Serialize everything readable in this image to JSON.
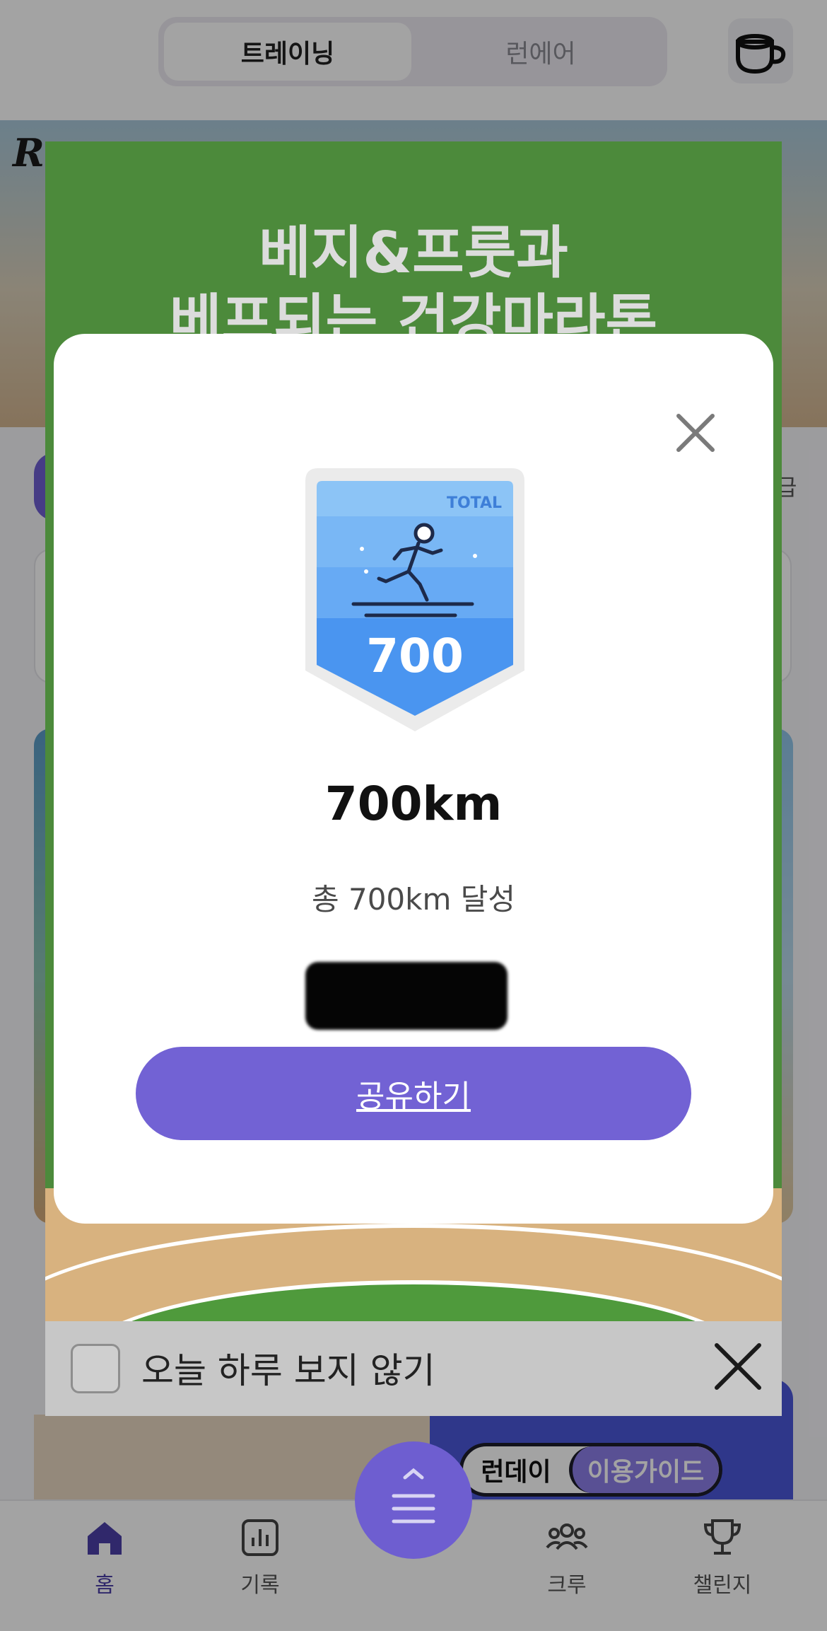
{
  "header": {
    "tabs": [
      {
        "label": "트레이닝",
        "active": true
      },
      {
        "label": "런에어",
        "active": false
      }
    ],
    "coffee_icon": "coffee-cup-icon"
  },
  "background": {
    "side_text": "급",
    "guide_banner": {
      "left": "런데이",
      "right": "이용가이드"
    }
  },
  "promo_popup": {
    "title_line1": "베지&프룻과",
    "title_line2": "베프되는 건강마라톤",
    "dont_show_label": "오늘 하루 보지 않기",
    "close_icon": "close-icon"
  },
  "badge_modal": {
    "badge_tag": "TOTAL",
    "badge_number": "700",
    "title": "700km",
    "description": "총 700km 달성",
    "share_label": "공유하기",
    "close_icon": "close-icon"
  },
  "bottom_nav": {
    "items": [
      {
        "label": "홈",
        "icon": "home-icon",
        "active": true
      },
      {
        "label": "기록",
        "icon": "chart-icon",
        "active": false
      },
      {
        "label": "크루",
        "icon": "people-icon",
        "active": false
      },
      {
        "label": "챌린지",
        "icon": "trophy-icon",
        "active": false
      }
    ],
    "menu_icon": "menu-icon"
  },
  "colors": {
    "accent": "#7262d4",
    "promo_green": "#4c8a3b",
    "badge_blue": "#3f8ef0"
  }
}
